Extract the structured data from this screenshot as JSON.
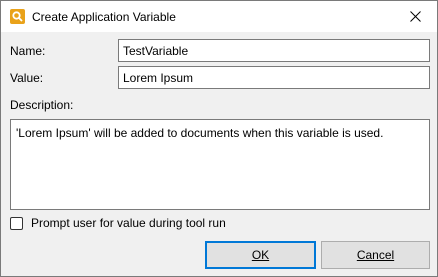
{
  "window": {
    "title": "Create Application Variable"
  },
  "form": {
    "name_label": "Name:",
    "name_value": "TestVariable",
    "value_label": "Value:",
    "value_value": "Lorem Ipsum",
    "description_label": "Description:",
    "description_text": "'Lorem Ipsum' will be added to documents when this variable is used.",
    "prompt_label": "Prompt user for value during tool run",
    "prompt_checked": false
  },
  "buttons": {
    "ok_label": "OK",
    "cancel_label": "Cancel"
  },
  "colors": {
    "accent": "#0078d7",
    "app_icon": "#e9a21a",
    "body_bg": "#f0f0f0"
  }
}
